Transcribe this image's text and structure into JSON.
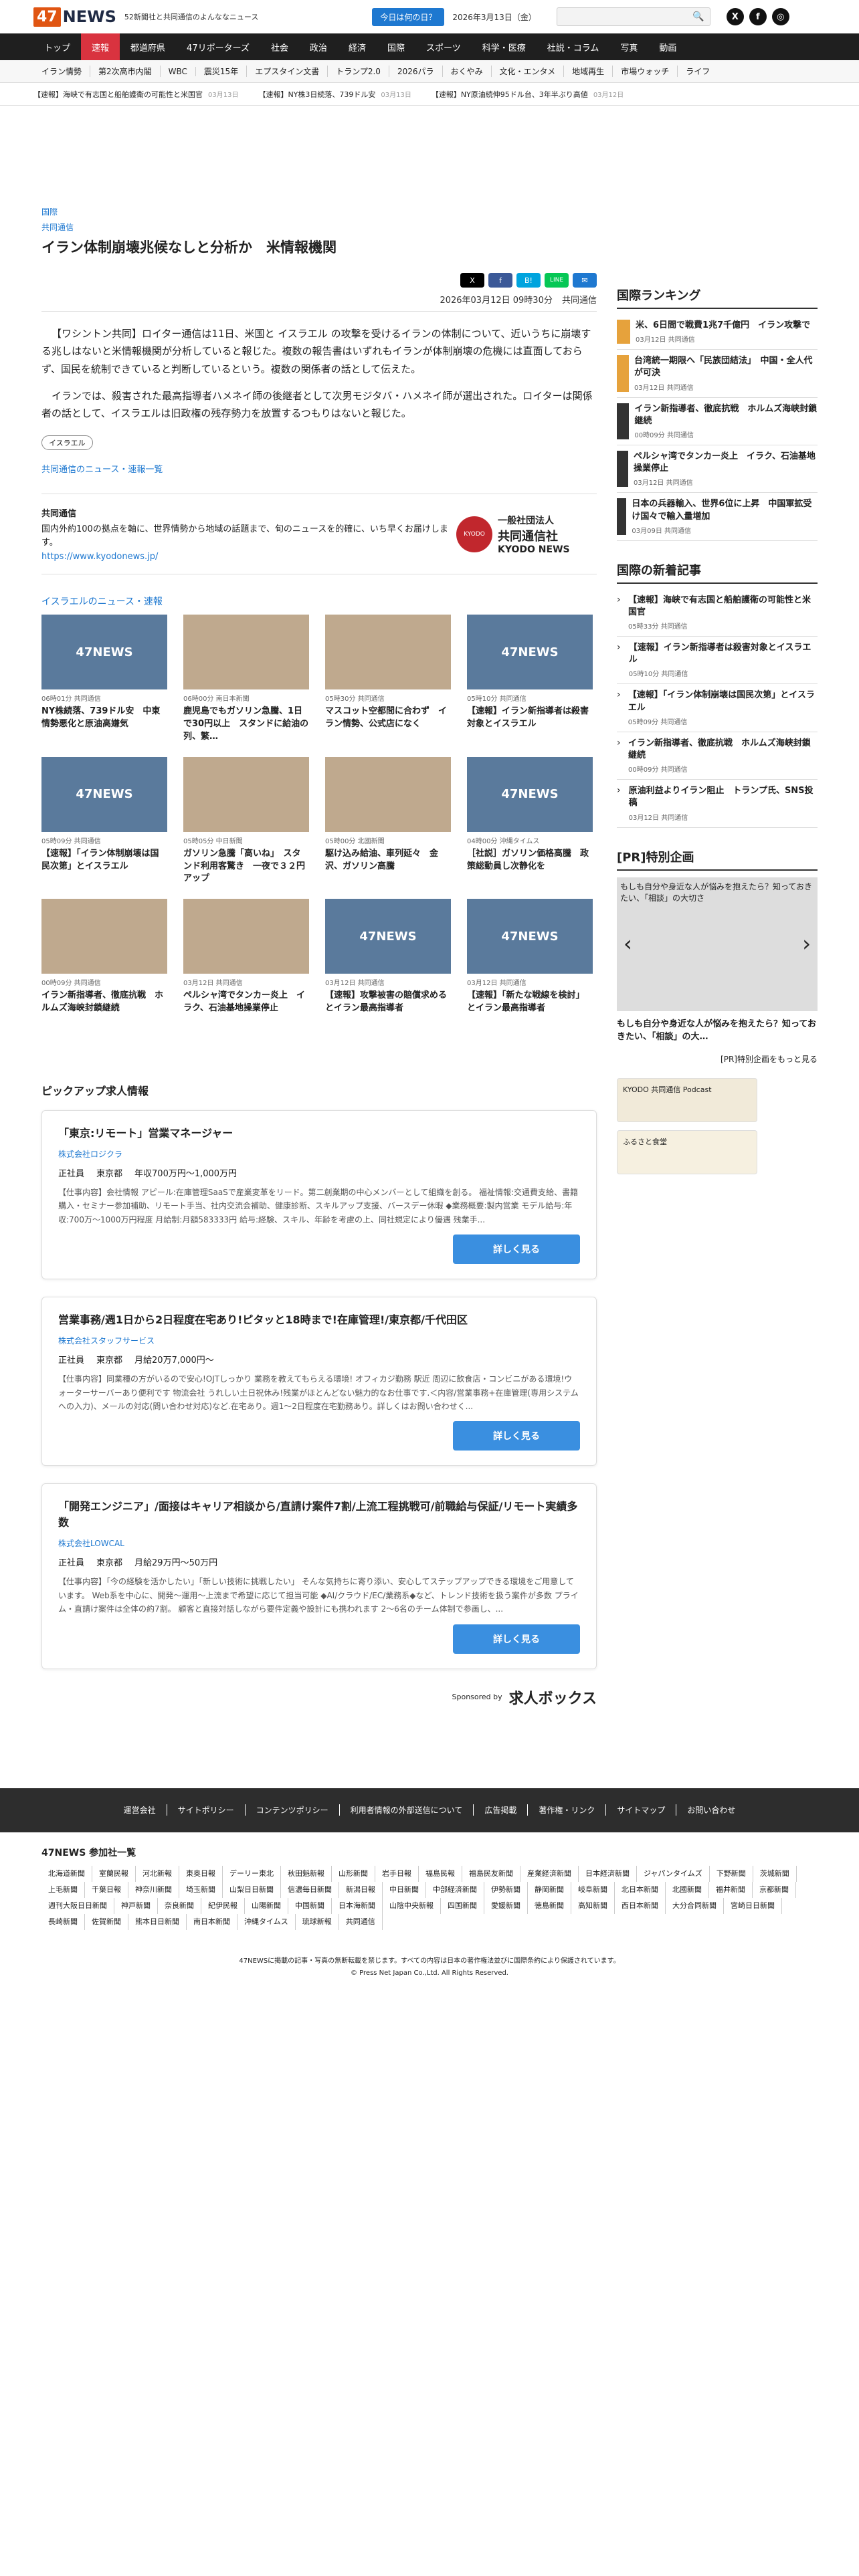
{
  "header": {
    "logo_47": "47",
    "logo_news": "NEWS",
    "tagline": "52新聞社と共同通信のよんななニュース",
    "today_btn": "今日は何の日？",
    "date": "2026年3月13日（金）"
  },
  "nav": [
    "トップ",
    "速報",
    "都道府県",
    "47リポーターズ",
    "社会",
    "政治",
    "経済",
    "国際",
    "スポーツ",
    "科学・医療",
    "社説・コラム",
    "写真",
    "動画"
  ],
  "subnav": [
    "イラン情勢",
    "第2次高市内閣",
    "WBC",
    "震災15年",
    "エプスタイン文書",
    "トランプ2.0",
    "2026パラ",
    "おくやみ",
    "文化・エンタメ",
    "地域再生",
    "市場ウォッチ",
    "ライフ"
  ],
  "ticker": [
    {
      "text": "【速報】海峡で有志国と船舶護衛の可能性と米国官",
      "time": "03月13日"
    },
    {
      "text": "【速報】NY株3日続落、739ドル安",
      "time": "03月13日"
    },
    {
      "text": "【速報】NY原油続伸95ドル台、3年半ぶり高値",
      "time": "03月12日"
    }
  ],
  "article": {
    "category": "国際",
    "source_top": "共同通信",
    "title": "イラン体制崩壊兆候なしと分析か　米情報機関",
    "share": [
      "X",
      "f",
      "B!",
      "LINE",
      "✉"
    ],
    "datetime": "2026年03月12日 09時30分",
    "source": "共同通信",
    "paragraphs": [
      "【ワシントン共同】ロイター通信は11日、米国と イスラエル の攻撃を受けるイランの体制について、近いうちに崩壊する兆しはないと米情報機関が分析していると報じた。複数の報告書はいずれもイランが体制崩壊の危機には直面しておらず、国民を統制できていると判断しているという。複数の関係者の話として伝えた。",
      "イランでは、殺害された最高指導者ハメネイ師の後継者として次男モジタバ・ハメネイ師が選出された。ロイターは関係者の話として、イスラエルは旧政権の残存勢力を放置するつもりはないと報じた。"
    ],
    "tag": "イスラエル",
    "more": "共同通信のニュース・速報一覧"
  },
  "kyodo": {
    "name": "共同通信",
    "desc": "国内外約100の拠点を軸に、世界情勢から地域の話題まで、旬のニュースを的確に、いち早くお届けします。",
    "url": "https://www.kyodonews.jp/",
    "logo_small": "一般社団法人",
    "logo_name": "共同通信社",
    "logo_en": "KYODO NEWS"
  },
  "related": {
    "title": "イスラエルのニュース・速報",
    "items": [
      {
        "meta": "06時01分 共同通信",
        "title": "NY株続落、739ドル安　中東情勢悪化と原油高嫌気",
        "img": "47NEWS"
      },
      {
        "meta": "06時00分 南日本新聞",
        "title": "鹿児島でもガソリン急騰、1日で30円以上　スタンドに給油の列、繁…",
        "img": ""
      },
      {
        "meta": "05時30分 共同通信",
        "title": "マスコット空都間に合わず　イラン情勢、公式店になく",
        "img": ""
      },
      {
        "meta": "05時10分 共同通信",
        "title": "【速報】イラン新指導者は殺害対象とイスラエル",
        "img": "47NEWS"
      },
      {
        "meta": "05時09分 共同通信",
        "title": "【速報】「イラン体制崩壊は国民次第」とイスラエル",
        "img": "47NEWS"
      },
      {
        "meta": "05時05分 中日新聞",
        "title": "ガソリン急騰「高いね」　スタンド利用客驚き　一夜で３２円アップ",
        "img": ""
      },
      {
        "meta": "05時00分 北國新聞",
        "title": "駆け込み給油、車列延々　金沢、ガソリン高騰",
        "img": ""
      },
      {
        "meta": "04時00分 沖縄タイムス",
        "title": "［社説］ガソリン価格高騰　政策総動員し次静化を",
        "img": "47NEWS"
      },
      {
        "meta": "00時09分 共同通信",
        "title": "イラン新指導者、徹底抗戦　ホルムズ海峡封鎖継続",
        "img": ""
      },
      {
        "meta": "03月12日 共同通信",
        "title": "ペルシャ湾でタンカー炎上　イラク、石油基地操業停止",
        "img": ""
      },
      {
        "meta": "03月12日 共同通信",
        "title": "【速報】攻撃被害の賠償求めるとイラン最高指導者",
        "img": "47NEWS"
      },
      {
        "meta": "03月12日 共同通信",
        "title": "【速報】「新たな戦線を検討」とイラン最高指導者",
        "img": "47NEWS"
      }
    ]
  },
  "pickup": {
    "title": "ピックアップ求人情報",
    "jobs": [
      {
        "title": "「東京:リモート」営業マネージャー",
        "company": "株式会社ロジクラ",
        "type": "正社員",
        "place": "東京都",
        "salary": "年収700万円〜1,000万円",
        "desc": "【仕事内容】会社情報 アピール:在庫管理SaaSで産業変革をリード。第二創業期の中心メンバーとして組織を創る。 福祉情報:交通費支給、書籍購入・セミナー参加補助、リモート手当、社内交流会補助、健康診断、スキルアップ支援、バースデー休暇 ◆業務概要:製内営業 モデル給与:年収:700万〜1000万円程度 月給制:月額583333円 給与:経験、スキル、年齢を考慮の上、同社規定により優遇 残業手..."
      },
      {
        "title": "営業事務/週1日から2日程度在宅あり!ピタッと18時まで!在庫管理!/東京都/千代田区",
        "company": "株式会社スタッフサービス",
        "type": "正社員",
        "place": "東京都",
        "salary": "月給20万7,000円〜",
        "desc": "【仕事内容】同業種の方がいるので安心!OJTしっかり 業務を教えてもらえる環境! オフィカジ勤務 駅近 周辺に飲食店・コンビニがある環境!ウォーターサーバーあり便利です 物流会社 うれしい土日祝休み!残業がほとんどない魅力的なお仕事です.＜内容/営業事務+在庫管理(専用システムへの入力)、メールの対応(問い合わせ対応)など.在宅あり。週1〜2日程度在宅勤務あり。詳しくはお問い合わせく..."
      },
      {
        "title": "「開発エンジニア」/面接はキャリア相談から/直請け案件7割/上流工程挑戦可/前職給与保証/リモート実績多数",
        "company": "株式会社LOWCAL",
        "type": "正社員",
        "place": "東京都",
        "salary": "月給29万円〜50万円",
        "desc": "【仕事内容】「今の経験を活かしたい」「新しい技術に挑戦したい」 そんな気持ちに寄り添い、安心してステップアップできる環境をご用意しています。 Web系を中心に、開発〜運用〜上流まで希望に応じて担当可能 ◆AI/クラウド/EC/業務系◆など、トレンド技術を扱う案件が多数 プライム・直請け案件は全体の約7割。 顧客と直接対話しながら要件定義や設計にも携われます 2〜6名のチーム体制で参画し、..."
      }
    ],
    "button": "詳しく見る",
    "sponsor_label": "Sponsored by",
    "sponsor_name": "求人ボックス"
  },
  "sidebar": {
    "ranking_title": "国際ランキング",
    "ranking": [
      {
        "title": "米、6日間で戦費1兆7千億円　イラン攻撃で",
        "meta": "03月12日 共同通信"
      },
      {
        "title": "台湾統一期限へ「民族団結法」　中国・全人代が可決",
        "meta": "03月12日 共同通信"
      },
      {
        "title": "イラン新指導者、徹底抗戦　ホルムズ海峡封鎖継続",
        "meta": "00時09分 共同通信"
      },
      {
        "title": "ペルシャ湾でタンカー炎上　イラク、石油基地操業停止",
        "meta": "03月12日 共同通信"
      },
      {
        "title": "日本の兵器輸入、世界6位に上昇　中国軍拡受け国々で輸入量増加",
        "meta": "03月09日 共同通信"
      }
    ],
    "latest_title": "国際の新着記事",
    "latest": [
      {
        "title": "【速報】海峡で有志国と船舶護衛の可能性と米国官",
        "meta": "05時33分 共同通信"
      },
      {
        "title": "【速報】イラン新指導者は殺害対象とイスラエル",
        "meta": "05時10分 共同通信"
      },
      {
        "title": "【速報】「イラン体制崩壊は国民次第」とイスラエル",
        "meta": "05時09分 共同通信"
      },
      {
        "title": "イラン新指導者、徹底抗戦　ホルムズ海峡封鎖継続",
        "meta": "00時09分 共同通信"
      },
      {
        "title": "原油利益よりイラン阻止　トランプ氏、SNS投稿",
        "meta": "03月12日 共同通信"
      }
    ],
    "pr_title": "[PR]特別企画",
    "pr_caption": "もしも自分や身近な人が悩みを抱えたら？知っておきたい、「相談」の大切さ",
    "pr_item": "もしも自分や身近な人が悩みを抱えたら？知っておきたい、「相談」の大…",
    "pr_more": "[PR]特別企画をもっと見る",
    "banner1": "KYODO 共同通信 Podcast",
    "banner2": "ふるさと食堂"
  },
  "footer": {
    "links": [
      "運営会社",
      "サイトポリシー",
      "コンテンツポリシー",
      "利用者情報の外部送信について",
      "広告掲載",
      "著作権・リンク",
      "サイトマップ",
      "お問い合わせ"
    ],
    "members_title": "47NEWS 参加社一覧",
    "members": [
      "北海道新聞",
      "室蘭民報",
      "河北新報",
      "東奥日報",
      "デーリー東北",
      "秋田魁新報",
      "山形新聞",
      "岩手日報",
      "福島民報",
      "福島民友新聞",
      "産業経済新聞",
      "日本経済新聞",
      "ジャパンタイムズ",
      "下野新聞",
      "茨城新聞",
      "上毛新聞",
      "千葉日報",
      "神奈川新聞",
      "埼玉新聞",
      "山梨日日新聞",
      "信濃毎日新聞",
      "新潟日報",
      "中日新聞",
      "中部経済新聞",
      "伊勢新聞",
      "静岡新聞",
      "岐阜新聞",
      "北日本新聞",
      "北國新聞",
      "福井新聞",
      "京都新聞",
      "週刊大阪日日新聞",
      "神戸新聞",
      "奈良新聞",
      "紀伊民報",
      "山陽新聞",
      "中国新聞",
      "日本海新聞",
      "山陰中央新報",
      "四国新聞",
      "愛媛新聞",
      "徳島新聞",
      "高知新聞",
      "西日本新聞",
      "大分合同新聞",
      "宮崎日日新聞",
      "長崎新聞",
      "佐賀新聞",
      "熊本日日新聞",
      "南日本新聞",
      "沖縄タイムス",
      "琉球新報",
      "共同通信"
    ],
    "notice": "47NEWSに掲載の記事・写真の無断転載を禁じます。すべての内容は日本の著作権法並びに国際条約により保護されています。",
    "copyright": "© Press Net Japan Co.,Ltd. All Rights Reserved."
  }
}
